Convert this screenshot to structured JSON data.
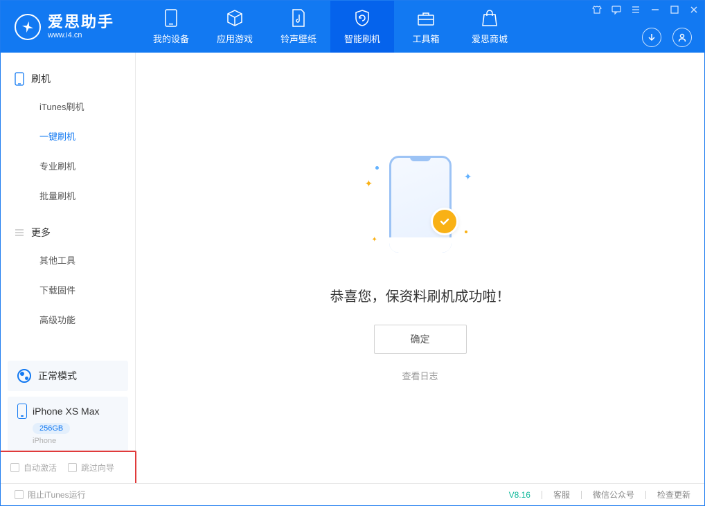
{
  "app": {
    "title": "爱思助手",
    "url": "www.i4.cn"
  },
  "nav": {
    "tabs": [
      {
        "label": "我的设备"
      },
      {
        "label": "应用游戏"
      },
      {
        "label": "铃声壁纸"
      },
      {
        "label": "智能刷机"
      },
      {
        "label": "工具箱"
      },
      {
        "label": "爱思商城"
      }
    ]
  },
  "sidebar": {
    "group1_title": "刷机",
    "group1_items": [
      {
        "label": "iTunes刷机"
      },
      {
        "label": "一键刷机"
      },
      {
        "label": "专业刷机"
      },
      {
        "label": "批量刷机"
      }
    ],
    "group2_title": "更多",
    "group2_items": [
      {
        "label": "其他工具"
      },
      {
        "label": "下载固件"
      },
      {
        "label": "高级功能"
      }
    ],
    "mode_label": "正常模式",
    "device": {
      "name": "iPhone XS Max",
      "storage": "256GB",
      "type": "iPhone"
    },
    "opts": {
      "auto_activate": "自动激活",
      "skip_guide": "跳过向导"
    }
  },
  "main": {
    "success_text": "恭喜您，保资料刷机成功啦！",
    "confirm_label": "确定",
    "log_link": "查看日志"
  },
  "footer": {
    "block_itunes": "阻止iTunes运行",
    "version": "V8.16",
    "links": {
      "service": "客服",
      "wechat": "微信公众号",
      "update": "检查更新"
    }
  }
}
